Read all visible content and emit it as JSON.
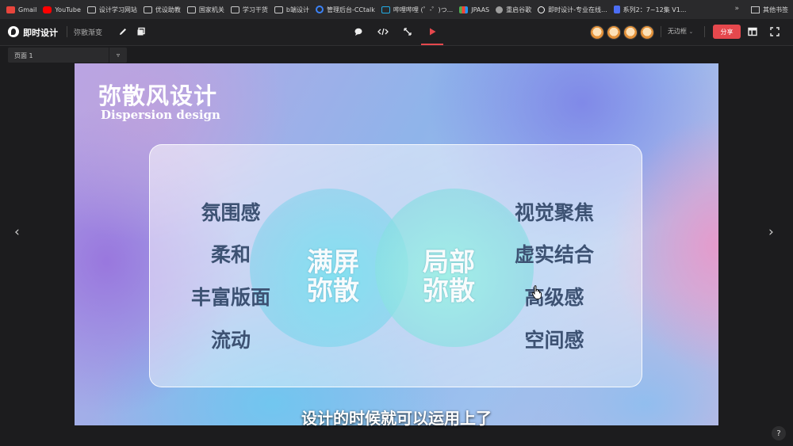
{
  "bookmarks": {
    "items": [
      {
        "label": "Gmail",
        "icon": "gmail-icon",
        "color": "#e8453c"
      },
      {
        "label": "YouTube",
        "icon": "youtube-icon",
        "color": "#ff0000"
      },
      {
        "label": "设计学习网站",
        "icon": "folder-icon",
        "color": "#c8c8c8"
      },
      {
        "label": "优设助教",
        "icon": "folder-icon",
        "color": "#c8c8c8"
      },
      {
        "label": "国家机关",
        "icon": "folder-icon",
        "color": "#c8c8c8"
      },
      {
        "label": "学习干货",
        "icon": "folder-icon",
        "color": "#c8c8c8"
      },
      {
        "label": "b端设计",
        "icon": "folder-icon",
        "color": "#c8c8c8"
      },
      {
        "label": "管理后台-CCtalk",
        "icon": "cctalk-icon",
        "color": "#3b82f6"
      },
      {
        "label": "哔哩哔哩 (゜-゜)つ...",
        "icon": "bilibili-icon",
        "color": "#23ade5"
      },
      {
        "label": "JPAAS",
        "icon": "jpaas-icon",
        "color": "#4caf50"
      },
      {
        "label": "重启谷歌",
        "icon": "globe-icon",
        "color": "#9e9e9e"
      },
      {
        "label": "即时设计-专业在线...",
        "icon": "jishi-icon",
        "color": "#ffffff"
      },
      {
        "label": "系列2：7~12集 V1...",
        "icon": "doc-icon",
        "color": "#4c6ef5"
      }
    ],
    "more": "»",
    "other": "其他书签"
  },
  "toolbar": {
    "app_name": "即时设计",
    "doc_name": "弥散渐变",
    "border_option": "无边框",
    "share_label": "分享"
  },
  "page_selector": {
    "label": "页面 1"
  },
  "slide": {
    "title": "弥散风设计",
    "subtitle": "Dispersion design",
    "left_words": [
      "氛围感",
      "柔和",
      "丰富版面",
      "流动"
    ],
    "right_words": [
      "视觉聚焦",
      "虚实结合",
      "高级感",
      "空间感"
    ],
    "left_center": [
      "满屏",
      "弥散"
    ],
    "right_center": [
      "局部",
      "弥散"
    ]
  },
  "caption": "设计的时候就可以运用上了",
  "nav": {
    "prev": "‹",
    "next": "›"
  },
  "help_label": "?",
  "colors": {
    "accent": "#e5484d",
    "keyword": "#3d5273"
  }
}
